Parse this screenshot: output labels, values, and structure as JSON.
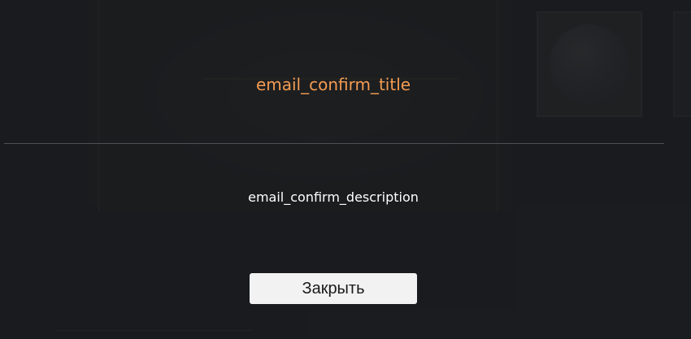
{
  "modal": {
    "title": "email_confirm_title",
    "description": "email_confirm_description",
    "close_label": "Закрыть"
  },
  "colors": {
    "title": "#f39c52",
    "overlay": "#1c1e22",
    "button_bg": "#f2f2f2",
    "background_accent": "#9c7420"
  }
}
